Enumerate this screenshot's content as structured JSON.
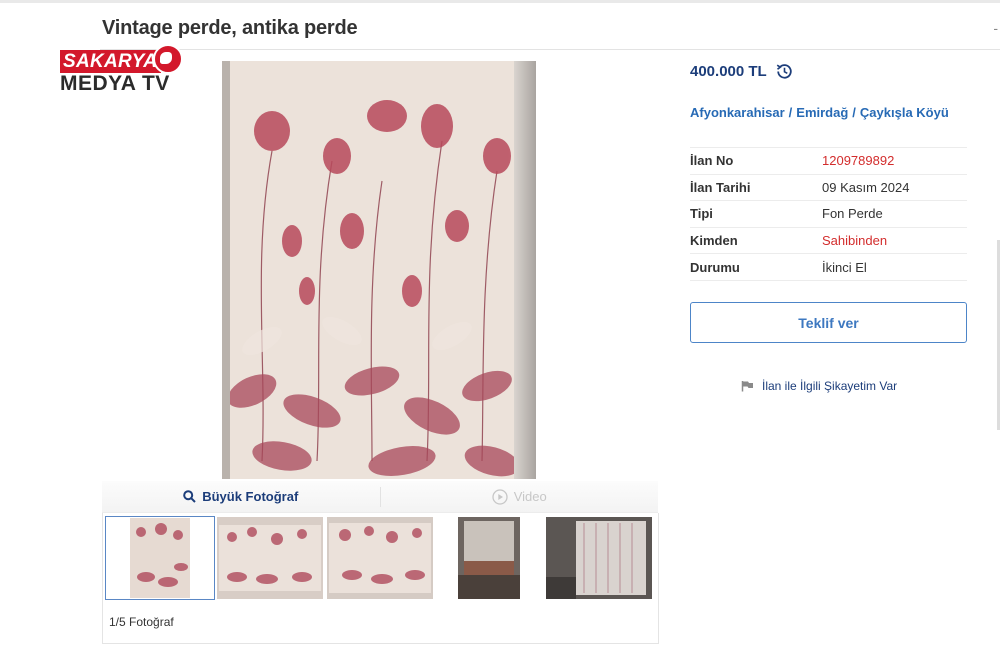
{
  "listing": {
    "title": "Vintage perde, antika perde",
    "title_extra": "-"
  },
  "watermark": {
    "top": "SAKARYA",
    "bottom": "MEDYA TV",
    "faint": "1209789892",
    "brand_color": "#d3182b"
  },
  "gallery": {
    "tab_big_photo": "Büyük Fotoğraf",
    "tab_video": "Video",
    "photo_count": "1/5 Fotoğraf",
    "thumbnails": [
      "photo-1",
      "photo-2",
      "photo-3",
      "photo-4",
      "photo-5"
    ],
    "selected_index": 0
  },
  "details": {
    "price": "400.000 TL",
    "location": {
      "city": "Afyonkarahisar",
      "district": "Emirdağ",
      "neighborhood": "Çaykışla Köyü",
      "separator": "/"
    },
    "rows": [
      {
        "label": "İlan No",
        "value": "1209789892",
        "highlight": true
      },
      {
        "label": "İlan Tarihi",
        "value": "09 Kasım 2024",
        "highlight": false
      },
      {
        "label": "Tipi",
        "value": "Fon Perde",
        "highlight": false
      },
      {
        "label": "Kimden",
        "value": "Sahibinden",
        "highlight": true
      },
      {
        "label": "Durumu",
        "value": "İkinci El",
        "highlight": false
      }
    ],
    "offer_button": "Teklif ver",
    "complaint_link": "İlan ile İlgili Şikayetim Var"
  },
  "colors": {
    "accent_blue": "#1c3d7a",
    "link_blue": "#276ab5",
    "highlight_red": "#d32d2d"
  },
  "icons": {
    "price_history": "history-icon",
    "big_photo": "search-icon",
    "video": "play-circle-icon",
    "complaint": "flag-icon"
  }
}
